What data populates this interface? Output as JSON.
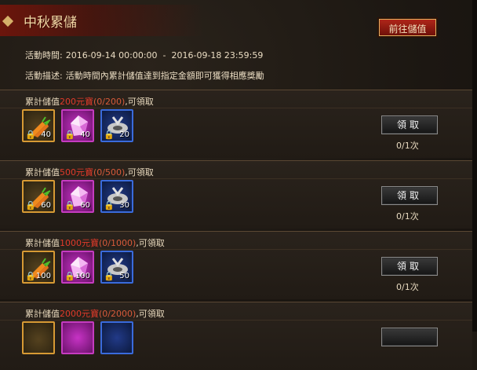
{
  "window": {
    "title": "中秋累儲",
    "goto_button": "前往儲值"
  },
  "info": {
    "time_label": "活動時間:",
    "time_value": "2016-09-14 00:00:00  -  2016-09-18 23:59:59",
    "desc_label": "活動描述:",
    "desc_value": "活動時間內累計儲值達到指定金額即可獲得相應獎勵"
  },
  "tiers": [
    {
      "prefix": "累計儲值",
      "amount": "200元寶",
      "progress": "(0/200)",
      "suffix": ",可領取",
      "items": [
        {
          "icon": "carrot-icon",
          "qty": "40"
        },
        {
          "icon": "crystal-icon",
          "qty": "40"
        },
        {
          "icon": "wheel-icon",
          "qty": "20"
        }
      ],
      "claim_label": "領取",
      "count": "0/1次"
    },
    {
      "prefix": "累計儲值",
      "amount": "500元寶",
      "progress": "(0/500)",
      "suffix": ",可領取",
      "items": [
        {
          "icon": "carrot-icon",
          "qty": "60"
        },
        {
          "icon": "crystal-icon",
          "qty": "60"
        },
        {
          "icon": "wheel-icon",
          "qty": "30"
        }
      ],
      "claim_label": "領取",
      "count": "0/1次"
    },
    {
      "prefix": "累計儲值",
      "amount": "1000元寶",
      "progress": "(0/1000)",
      "suffix": ",可領取",
      "items": [
        {
          "icon": "carrot-icon",
          "qty": "100"
        },
        {
          "icon": "crystal-icon",
          "qty": "100"
        },
        {
          "icon": "wheel-icon",
          "qty": "50"
        }
      ],
      "claim_label": "領取",
      "count": "0/1次"
    },
    {
      "prefix": "累計儲值",
      "amount": "2000元寶",
      "progress": "(0/2000)",
      "suffix": ",可領取",
      "items": [],
      "claim_label": "",
      "count": ""
    }
  ],
  "colors": {
    "accent_red": "#e03a2a",
    "title_gold": "#f3d9a6",
    "frame_gold": "#c48a2a"
  }
}
